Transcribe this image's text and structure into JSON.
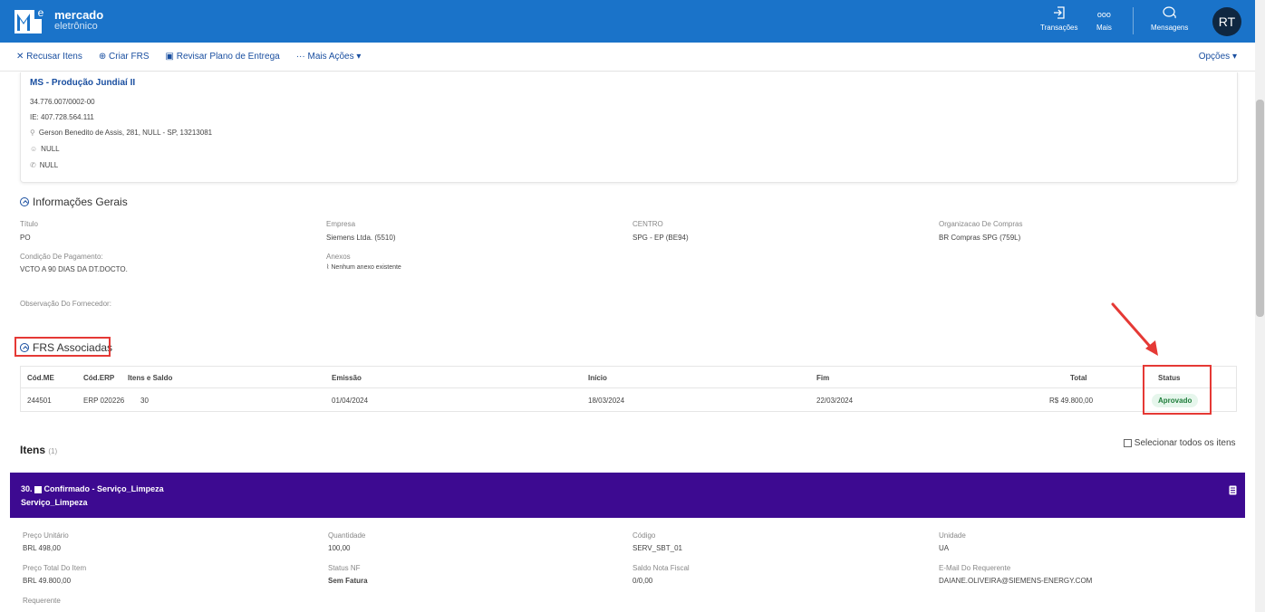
{
  "header": {
    "brand_line1": "mercado",
    "brand_line2": "eletrônico",
    "transacoes": "Transações",
    "mais": "Mais",
    "mais_glyph": "ooo",
    "mensagens": "Mensagens",
    "avatar_initials": "RT",
    "colors": {
      "bar": "#1a73c9",
      "avatar": "#0f2741"
    }
  },
  "actions": {
    "recusar": "Recusar Itens",
    "criar": "Criar FRS",
    "revisar": "Revisar Plano de Entrega",
    "mais_acoes": "Mais Ações",
    "opcoes": "Opções"
  },
  "address": {
    "name": "MS - Produção Jundiaí II",
    "cnpj": "34.776.007/0002-00",
    "ie": "IE: 407.728.564.111",
    "street": "Gerson Benedito de Assis, 281, NULL - SP, 13213081",
    "person": "NULL",
    "phone": "NULL"
  },
  "info": {
    "title": "Informações Gerais",
    "fields": [
      {
        "label": "Título",
        "value": "PO"
      },
      {
        "label": "Empresa",
        "value": "Siemens Ltda. (5510)"
      },
      {
        "label": "CENTRO",
        "value": "SPG - EP (BE94)"
      },
      {
        "label": "Organizacao De Compras",
        "value": "BR Compras SPG (759L)"
      },
      {
        "label": "Condição De Pagamento:",
        "value": "VCTO A 90 DIAS DA DT.DOCTO."
      },
      {
        "label": "Anexos",
        "value": "Nenhum anexo existente"
      },
      {
        "label": "Observação Do Fornecedor:",
        "value": ""
      }
    ]
  },
  "frs": {
    "title": "FRS Associadas",
    "headers": [
      "Cód.ME",
      "Cód.ERP",
      "Itens e Saldo",
      "Emissão",
      "Início",
      "Fim",
      "Total",
      "Status"
    ],
    "row": {
      "cod_me": "244501",
      "cod_erp": "ERP 020226",
      "itens": "30",
      "emissao": "01/04/2024",
      "inicio": "18/03/2024",
      "fim": "22/03/2024",
      "total": "R$ 49.800,00",
      "status": "Aprovado"
    }
  },
  "itens": {
    "title": "Itens",
    "count": "(1)",
    "select_all": "Selecionar todos os itens",
    "item": {
      "number": "30.",
      "status": "Confirmado",
      "name": " - Serviço_Limpeza",
      "subtitle": "Serviço_Limpeza",
      "color": "#3d0a91"
    },
    "fields": [
      {
        "label": "Preço Unitário",
        "value": "BRL 498,00"
      },
      {
        "label": "Quantidade",
        "value": "100,00"
      },
      {
        "label": "Código",
        "value": "SERV_SBT_01"
      },
      {
        "label": "Unidade",
        "value": "UA"
      },
      {
        "label": "Preço Total Do Item",
        "value": "BRL 49.800,00"
      },
      {
        "label": "Status NF",
        "value": "Sem Fatura"
      },
      {
        "label": "Saldo Nota Fiscal",
        "value": "0/0,00"
      },
      {
        "label": "E-Mail Do Requerente",
        "value": "DAIANE.OLIVEIRA@SIEMENS-ENERGY.COM"
      },
      {
        "label": "Requerente",
        "value": ""
      }
    ]
  }
}
